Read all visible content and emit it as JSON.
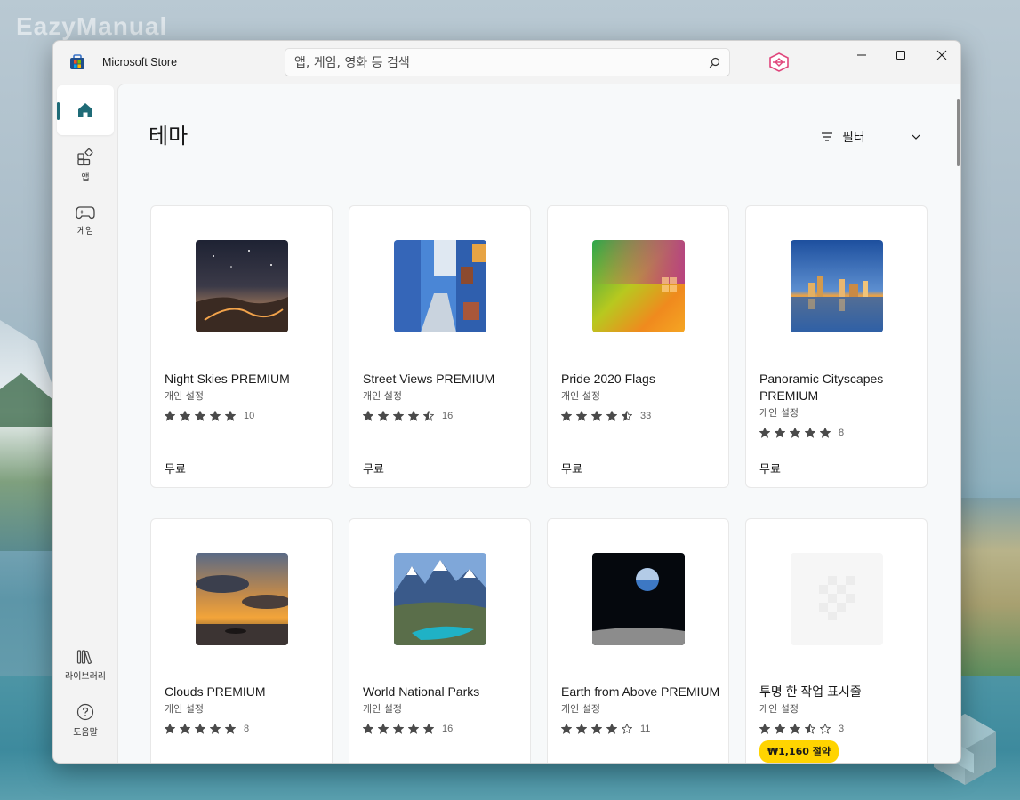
{
  "watermark": "EazyManual",
  "window": {
    "title": "Microsoft Store",
    "search_placeholder": "앱, 게임, 영화 등 검색"
  },
  "sidebar": {
    "items": [
      {
        "name": "home",
        "label": ""
      },
      {
        "name": "apps",
        "label": "앱"
      },
      {
        "name": "games",
        "label": "게임"
      }
    ],
    "bottom": [
      {
        "name": "library",
        "label": "라이브러리"
      },
      {
        "name": "help",
        "label": "도움말"
      }
    ]
  },
  "page": {
    "title": "테마",
    "filter_label": "필터"
  },
  "cards": [
    {
      "title": "Night Skies PREMIUM",
      "subtitle": "개인 설정",
      "stars": 5,
      "rating_count": "10",
      "price": "무료",
      "thumb": "night-skies"
    },
    {
      "title": "Street Views PREMIUM",
      "subtitle": "개인 설정",
      "stars": 4.5,
      "rating_count": "16",
      "price": "무료",
      "thumb": "street-views"
    },
    {
      "title": "Pride 2020 Flags",
      "subtitle": "개인 설정",
      "stars": 4.5,
      "rating_count": "33",
      "price": "무료",
      "thumb": "pride-flags"
    },
    {
      "title": "Panoramic Cityscapes PREMIUM",
      "subtitle": "개인 설정",
      "stars": 5,
      "rating_count": "8",
      "price": "무료",
      "thumb": "cityscapes"
    },
    {
      "title": "Clouds PREMIUM",
      "subtitle": "개인 설정",
      "stars": 5,
      "rating_count": "8",
      "price": "",
      "thumb": "clouds"
    },
    {
      "title": "World National Parks",
      "subtitle": "개인 설정",
      "stars": 5,
      "rating_count": "16",
      "price": "",
      "thumb": "national-parks"
    },
    {
      "title": "Earth from Above PREMIUM",
      "subtitle": "개인 설정",
      "stars": 4,
      "rating_count": "11",
      "price": "",
      "thumb": "earth-above"
    },
    {
      "title": "투명 한 작업 표시줄",
      "subtitle": "개인 설정",
      "stars": 3.5,
      "rating_count": "3",
      "price_badge": "₩1,160 절약",
      "thumb": "transparent"
    }
  ],
  "colors": {
    "accent": "#1f6b77",
    "star": "#4a4a4a",
    "price_badge": "#ffd400"
  }
}
